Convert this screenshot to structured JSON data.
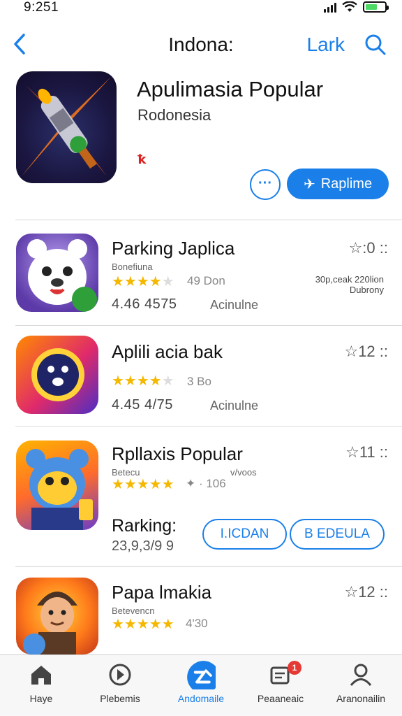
{
  "status_bar": {
    "time": "9:251"
  },
  "nav": {
    "title": "Indona:",
    "link": "Lark"
  },
  "hero": {
    "title": "Apulimasia Popular",
    "subtitle": "Rodonesia",
    "mark": "ꝁ",
    "more_label": "···",
    "primary_label": "Raplime"
  },
  "apps": [
    {
      "name": "Parking Japlica",
      "developer": "Bonefiuna",
      "rating_fraction": 0.7,
      "rating_count": "49 Don",
      "meta": "4.46 4575",
      "category": "Acinulne",
      "rank": "☆:0 ::",
      "extra_line1": "30p,ceak 220lion",
      "extra_line2": "Dubrony"
    },
    {
      "name": "Aplili acia bak",
      "developer": "",
      "rating_fraction": 0.7,
      "rating_count": "3 Bo",
      "meta": "4.45 4/75",
      "category": "Acinulne",
      "rank": "☆12 ::"
    },
    {
      "name": "Rpllaxis Popular",
      "developer": "Betecu",
      "developer_right": "v/voos",
      "rating_fraction": 0.8,
      "rating_count": "✦ · 106",
      "rank": "☆11 ::",
      "ranking_label": "Rarking:",
      "ranking_value": "23,9,3/9 9",
      "btn_a": "I.ICDAN",
      "btn_b": "B EDEULA"
    },
    {
      "name": "Papa lmakia",
      "developer": "Betevencn",
      "rating_fraction": 0.8,
      "rating_count": "4'30",
      "rank": "☆12 ::"
    }
  ],
  "tabs": [
    {
      "label": "Haye",
      "icon": "home-icon",
      "active": false
    },
    {
      "label": "Plebemis",
      "icon": "compass-icon",
      "active": false
    },
    {
      "label": "Andomaile",
      "icon": "apps-icon",
      "active": true
    },
    {
      "label": "Peaaneaic",
      "icon": "notifications-icon",
      "active": false,
      "badge": "1"
    },
    {
      "label": "Aranonailin",
      "icon": "profile-icon",
      "active": false
    }
  ],
  "colors": {
    "accent": "#1a7fe8",
    "star": "#f5b800",
    "badge": "#e53935"
  }
}
